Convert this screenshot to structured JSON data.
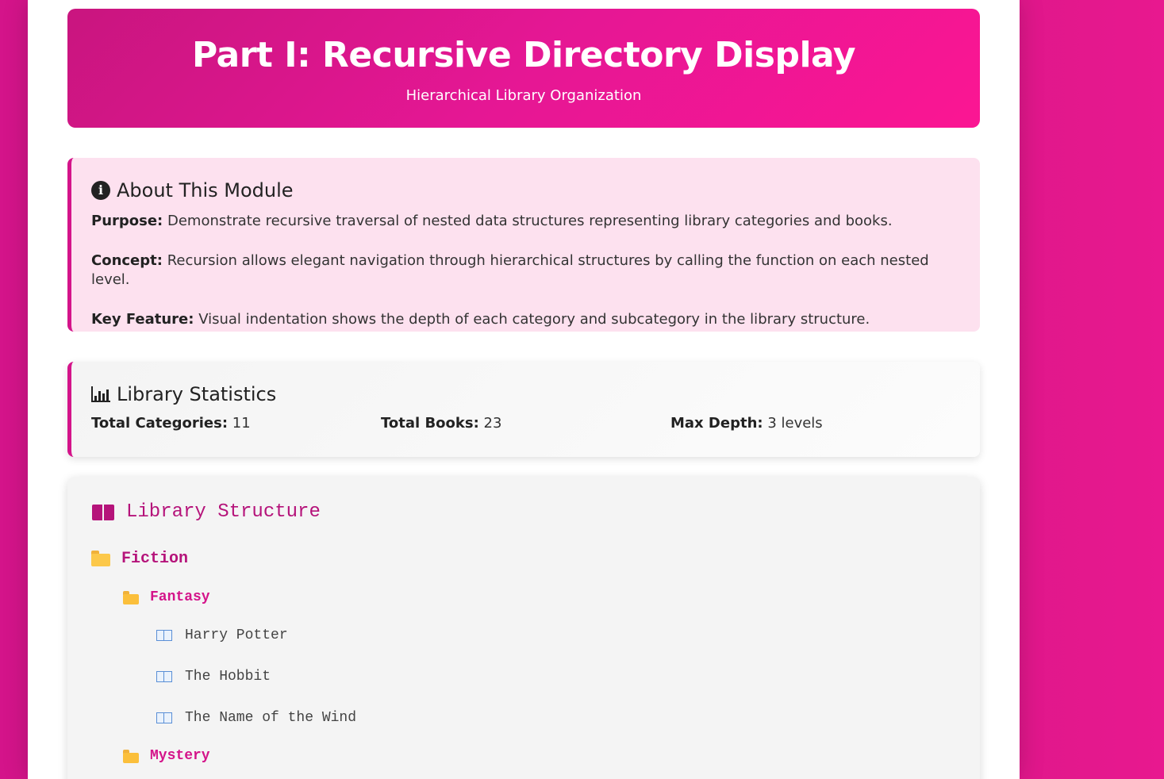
{
  "header": {
    "title": "Part I: Recursive Directory Display",
    "subtitle": "Hierarchical Library Organization"
  },
  "about": {
    "icon": "info-circle-icon",
    "title": "About This Module",
    "purpose_label": "Purpose:",
    "purpose_text": " Demonstrate recursive traversal of nested data structures representing library categories and books.",
    "concept_label": "Concept:",
    "concept_text": " Recursion allows elegant navigation through hierarchical structures by calling the function on each nested level.",
    "feature_label": "Key Feature:",
    "feature_text": " Visual indentation shows the depth of each category and subcategory in the library structure."
  },
  "stats": {
    "icon": "bar-chart-icon",
    "title": "Library Statistics",
    "categories_label": "Total Categories:",
    "categories_value": " 11",
    "books_label": "Total Books:",
    "books_value": " 23",
    "depth_label": "Max Depth:",
    "depth_value": " 3 levels"
  },
  "structure": {
    "icon": "open-book-icon",
    "title": "Library Structure",
    "tree": {
      "fiction": "Fiction",
      "fantasy": "Fantasy",
      "books": [
        "Harry Potter",
        "The Hobbit",
        "The Name of the Wind"
      ],
      "mystery": "Mystery"
    }
  },
  "colors": {
    "accent": "#d4148a",
    "accent_dark": "#b5137a",
    "about_bg": "#fde1ef"
  }
}
